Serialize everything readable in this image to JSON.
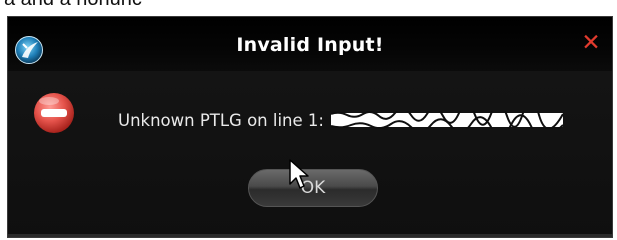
{
  "background_text": "a and a nonunc",
  "dialog": {
    "title": "Invalid Input!",
    "close_glyph": "✕",
    "message": "Unknown PTLG on line 1:",
    "ok_label": "OK",
    "icons": {
      "app": "app-logo-icon",
      "error": "error-stop-icon",
      "close": "close-icon",
      "cursor": "mouse-pointer-icon"
    }
  },
  "colors": {
    "dialog_bg": "#0e0e0e",
    "title_text": "#ffffff",
    "close_red": "#e23b2e",
    "error_red": "#e5534b"
  }
}
